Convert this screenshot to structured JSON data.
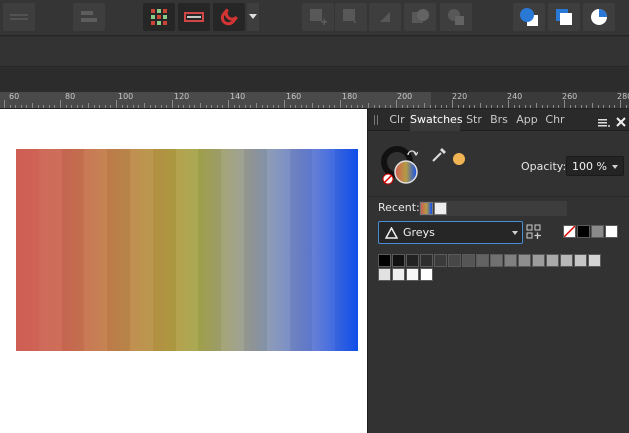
{
  "ruler": {
    "labels": [
      "60",
      "80",
      "100",
      "120",
      "140",
      "160",
      "180",
      "200",
      "220",
      "240",
      "260",
      "280"
    ]
  },
  "panel": {
    "tabs": [
      "Clr",
      "Swatches",
      "Str",
      "Brs",
      "App",
      "Chr"
    ],
    "active_tab": "Swatches",
    "opacity_label": "Opacity:",
    "opacity_value": "100 %",
    "recent_label": "Recent:",
    "palette_name": "Greys",
    "fill_color": "#f0b454",
    "gradient_strip": [
      "#cf5d55",
      "#b49b43",
      "#1150ef"
    ],
    "greys_row1": [
      "#000000",
      "#111111",
      "#222222",
      "#2e2e2e",
      "#3b3b3b",
      "#474747",
      "#555555",
      "#636363",
      "#717171",
      "#808080",
      "#8e8e8e",
      "#9c9c9c",
      "#aaaaaa",
      "#b8b8b8",
      "#c6c6c6",
      "#d4d4d4"
    ],
    "greys_row2": [
      "#e2e2e2",
      "#eeeeee",
      "#f7f7f7",
      "#ffffff"
    ],
    "quick_swatches": [
      "none",
      "#000000",
      "#8a8a8a",
      "#ffffff"
    ]
  }
}
